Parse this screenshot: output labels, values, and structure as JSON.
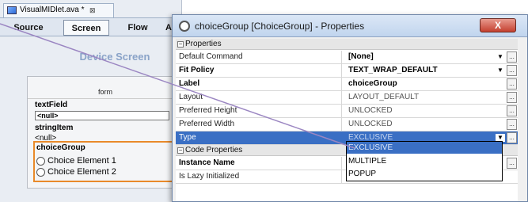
{
  "editor": {
    "doc_tab_title": "VisualMIDlet.ava *",
    "doc_tab_close": "⊠",
    "tabs": [
      "Source",
      "Screen",
      "Flow"
    ],
    "tab_overflow": "A",
    "device_screen_title": "Device Screen",
    "form_label": "form",
    "items": {
      "text_field_label": "textField",
      "text_field_value": "<null>",
      "string_item_label": "stringItem",
      "string_item_value": "<null>",
      "choice_group_label": "choiceGroup",
      "choice_1": "Choice Element 1",
      "choice_2": "Choice Element 2"
    }
  },
  "dialog": {
    "title": "choiceGroup [ChoiceGroup] - Properties",
    "close_label": "X",
    "sections": {
      "properties": "Properties",
      "code_properties": "Code Properties"
    },
    "rows": [
      {
        "key": "Default Command",
        "value": "[None]"
      },
      {
        "key": "Fit Policy",
        "value": "TEXT_WRAP_DEFAULT"
      },
      {
        "key": "Label",
        "value": "choiceGroup"
      },
      {
        "key": "Layout",
        "value": "LAYOUT_DEFAULT"
      },
      {
        "key": "Preferred Height",
        "value": "UNLOCKED"
      },
      {
        "key": "Preferred Width",
        "value": "UNLOCKED"
      },
      {
        "key": "Type",
        "value": "EXCLUSIVE"
      }
    ],
    "code_rows": [
      {
        "key": "Instance Name",
        "value": ""
      },
      {
        "key": "Is Lazy Initialized",
        "value": ""
      }
    ],
    "type_options": [
      "EXCLUSIVE",
      "MULTIPLE",
      "POPUP"
    ],
    "ellipsis": "...",
    "arrow": "▼"
  },
  "colors": {
    "selection": "#3a6fc4",
    "highlight_border": "#e98a2a",
    "leader_line": "#9b86c2"
  }
}
